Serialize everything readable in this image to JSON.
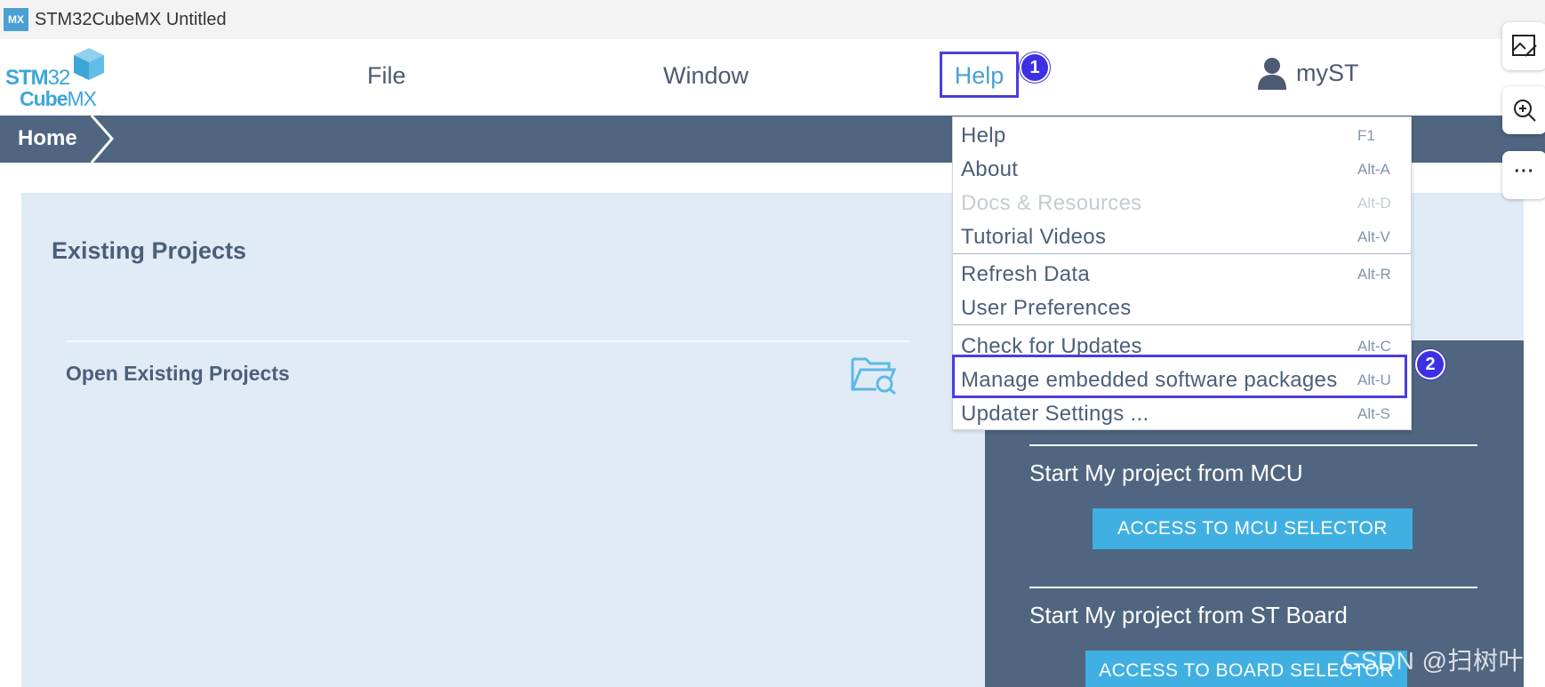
{
  "titlebar": {
    "icon_text": "MX",
    "title": "STM32CubeMX Untitled"
  },
  "logo": {
    "line1_bold": "STM",
    "line1_light": "32",
    "line2_bold": "Cube",
    "line2_light": "MX"
  },
  "menubar": {
    "file": "File",
    "window": "Window",
    "help": "Help",
    "myst": "myST"
  },
  "annotations": {
    "step1": "1",
    "step2": "2"
  },
  "breadcrumb": {
    "home": "Home"
  },
  "main": {
    "existing_title": "Existing Projects",
    "open_existing": "Open Existing Projects"
  },
  "new_project": {
    "mcu_label": "Start My project from MCU",
    "mcu_button": "ACCESS TO MCU SELECTOR",
    "board_label": "Start My project from ST Board",
    "board_button": "ACCESS TO BOARD SELECTOR"
  },
  "help_menu": {
    "items": [
      {
        "label": "Help",
        "shortcut": "F1",
        "enabled": true
      },
      {
        "label": "About",
        "shortcut": "Alt-A",
        "enabled": true
      },
      {
        "label": "Docs & Resources",
        "shortcut": "Alt-D",
        "enabled": false
      },
      {
        "label": "Tutorial Videos",
        "shortcut": "Alt-V",
        "enabled": true
      },
      {
        "label": "Refresh Data",
        "shortcut": "Alt-R",
        "enabled": true
      },
      {
        "label": "User Preferences",
        "shortcut": "",
        "enabled": true
      },
      {
        "label": "Check for Updates",
        "shortcut": "Alt-C",
        "enabled": true
      },
      {
        "label": "Manage embedded software packages",
        "shortcut": "Alt-U",
        "enabled": true
      },
      {
        "label": "Updater Settings ...",
        "shortcut": "Alt-S",
        "enabled": true
      }
    ]
  },
  "side_tools": {
    "more": "···"
  },
  "watermark": "CSDN @扫树叶",
  "colors": {
    "nav_dark": "#4f6580",
    "main_bg": "#e1ebf6",
    "accent_blue": "#40b0e3",
    "annotation": "#3d2fe3"
  }
}
